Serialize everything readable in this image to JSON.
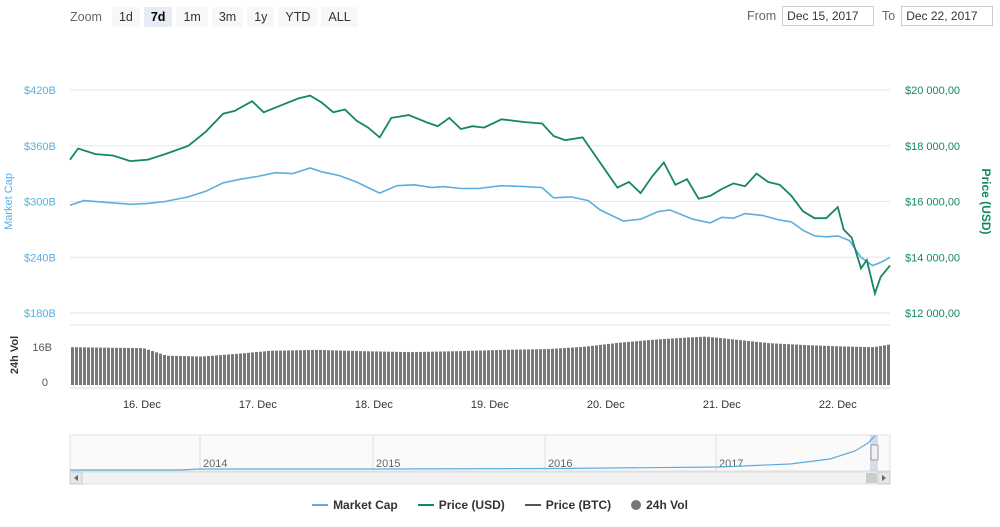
{
  "toolbar": {
    "zoom_label": "Zoom",
    "zoom_buttons": [
      "1d",
      "7d",
      "1m",
      "3m",
      "1y",
      "YTD",
      "ALL"
    ],
    "active_zoom": "7d",
    "from_label": "From",
    "from_value": "Dec 15, 2017",
    "to_label": "To",
    "to_value": "Dec 22, 2017"
  },
  "chart_data": {
    "type": "line",
    "left_axis": {
      "title": "Market Cap",
      "ticks": [
        "$180B",
        "$240B",
        "$300B",
        "$360B",
        "$420B"
      ],
      "ylim": [
        180,
        420
      ],
      "color": "#5aaee0"
    },
    "right_axis": {
      "title": "Price (USD)",
      "ticks": [
        "$12 000,00",
        "$14 000,00",
        "$16 000,00",
        "$18 000,00",
        "$20 000,00"
      ],
      "ylim": [
        12000,
        20000
      ],
      "color": "#14895c"
    },
    "volume_axis": {
      "title": "24h Vol",
      "ticks": [
        "0",
        "16B"
      ]
    },
    "x_ticks": [
      "16. Dec",
      "17. Dec",
      "18. Dec",
      "19. Dec",
      "20. Dec",
      "21. Dec",
      "22. Dec"
    ],
    "x_range": [
      15.38,
      22.45
    ],
    "price_usd": [
      [
        15.38,
        17500
      ],
      [
        15.45,
        17900
      ],
      [
        15.6,
        17700
      ],
      [
        15.75,
        17650
      ],
      [
        15.9,
        17450
      ],
      [
        16.05,
        17500
      ],
      [
        16.2,
        17700
      ],
      [
        16.4,
        18000
      ],
      [
        16.55,
        18500
      ],
      [
        16.7,
        19150
      ],
      [
        16.8,
        19250
      ],
      [
        16.95,
        19600
      ],
      [
        17.05,
        19200
      ],
      [
        17.2,
        19450
      ],
      [
        17.35,
        19700
      ],
      [
        17.45,
        19800
      ],
      [
        17.55,
        19550
      ],
      [
        17.65,
        19200
      ],
      [
        17.75,
        19300
      ],
      [
        17.85,
        18900
      ],
      [
        17.95,
        18650
      ],
      [
        18.05,
        18300
      ],
      [
        18.15,
        19000
      ],
      [
        18.3,
        19100
      ],
      [
        18.45,
        18850
      ],
      [
        18.55,
        18700
      ],
      [
        18.65,
        19000
      ],
      [
        18.75,
        18600
      ],
      [
        18.85,
        18700
      ],
      [
        18.95,
        18650
      ],
      [
        19.1,
        18950
      ],
      [
        19.3,
        18850
      ],
      [
        19.45,
        18800
      ],
      [
        19.55,
        18350
      ],
      [
        19.65,
        18200
      ],
      [
        19.8,
        18300
      ],
      [
        19.9,
        17700
      ],
      [
        20.0,
        17100
      ],
      [
        20.1,
        16500
      ],
      [
        20.2,
        16700
      ],
      [
        20.3,
        16300
      ],
      [
        20.4,
        16900
      ],
      [
        20.5,
        17400
      ],
      [
        20.6,
        16600
      ],
      [
        20.7,
        16800
      ],
      [
        20.8,
        16100
      ],
      [
        20.9,
        16200
      ],
      [
        21.0,
        16450
      ],
      [
        21.1,
        16650
      ],
      [
        21.2,
        16550
      ],
      [
        21.3,
        17000
      ],
      [
        21.4,
        16700
      ],
      [
        21.5,
        16600
      ],
      [
        21.6,
        16200
      ],
      [
        21.7,
        15650
      ],
      [
        21.8,
        15400
      ],
      [
        21.9,
        15400
      ],
      [
        22.0,
        15800
      ],
      [
        22.05,
        15000
      ],
      [
        22.12,
        14700
      ],
      [
        22.2,
        13600
      ],
      [
        22.25,
        13900
      ],
      [
        22.32,
        12700
      ],
      [
        22.37,
        13300
      ],
      [
        22.45,
        13700
      ]
    ],
    "market_cap": [
      [
        15.38,
        296
      ],
      [
        15.5,
        301
      ],
      [
        15.7,
        299
      ],
      [
        15.9,
        297
      ],
      [
        16.05,
        298
      ],
      [
        16.2,
        300
      ],
      [
        16.4,
        305
      ],
      [
        16.55,
        311
      ],
      [
        16.7,
        320
      ],
      [
        16.85,
        324
      ],
      [
        17.0,
        327
      ],
      [
        17.15,
        331
      ],
      [
        17.3,
        330
      ],
      [
        17.45,
        336
      ],
      [
        17.55,
        332
      ],
      [
        17.7,
        328
      ],
      [
        17.85,
        321
      ],
      [
        17.95,
        315
      ],
      [
        18.05,
        309
      ],
      [
        18.2,
        317
      ],
      [
        18.35,
        318
      ],
      [
        18.5,
        315
      ],
      [
        18.6,
        316
      ],
      [
        18.75,
        314
      ],
      [
        18.9,
        314
      ],
      [
        19.1,
        317
      ],
      [
        19.3,
        316
      ],
      [
        19.45,
        315
      ],
      [
        19.55,
        304
      ],
      [
        19.7,
        305
      ],
      [
        19.85,
        301
      ],
      [
        19.95,
        291
      ],
      [
        20.05,
        285
      ],
      [
        20.15,
        279
      ],
      [
        20.3,
        281
      ],
      [
        20.45,
        289
      ],
      [
        20.55,
        291
      ],
      [
        20.65,
        286
      ],
      [
        20.75,
        281
      ],
      [
        20.9,
        277
      ],
      [
        21.0,
        283
      ],
      [
        21.1,
        282
      ],
      [
        21.2,
        287
      ],
      [
        21.35,
        285
      ],
      [
        21.5,
        280
      ],
      [
        21.6,
        278
      ],
      [
        21.7,
        269
      ],
      [
        21.8,
        263
      ],
      [
        21.9,
        262
      ],
      [
        22.0,
        263
      ],
      [
        22.1,
        258
      ],
      [
        22.2,
        240
      ],
      [
        22.3,
        231
      ],
      [
        22.38,
        235
      ],
      [
        22.45,
        240
      ]
    ],
    "volume": [
      [
        15.38,
        0.85
      ],
      [
        16.0,
        0.83
      ],
      [
        16.2,
        0.66
      ],
      [
        16.5,
        0.64
      ],
      [
        16.8,
        0.7
      ],
      [
        17.1,
        0.77
      ],
      [
        17.5,
        0.79
      ],
      [
        17.9,
        0.76
      ],
      [
        18.3,
        0.74
      ],
      [
        18.7,
        0.76
      ],
      [
        19.1,
        0.79
      ],
      [
        19.5,
        0.81
      ],
      [
        19.8,
        0.86
      ],
      [
        20.1,
        0.95
      ],
      [
        20.4,
        1.02
      ],
      [
        20.7,
        1.07
      ],
      [
        20.85,
        1.09
      ],
      [
        21.0,
        1.05
      ],
      [
        21.4,
        0.94
      ],
      [
        21.7,
        0.9
      ],
      [
        22.0,
        0.87
      ],
      [
        22.3,
        0.85
      ],
      [
        22.45,
        0.92
      ]
    ]
  },
  "navigator": {
    "year_labels": [
      "2014",
      "2015",
      "2016",
      "2017"
    ]
  },
  "legend": [
    {
      "label": "Market Cap",
      "color": "#5aaee0",
      "kind": "line"
    },
    {
      "label": "Price (USD)",
      "color": "#14895c",
      "kind": "line"
    },
    {
      "label": "Price (BTC)",
      "color": "#555555",
      "kind": "line"
    },
    {
      "label": "24h Vol",
      "color": "#777777",
      "kind": "dot"
    }
  ]
}
